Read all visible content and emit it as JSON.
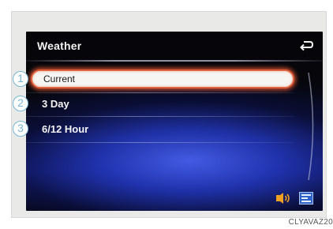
{
  "screen": {
    "title": "Weather",
    "back_icon": "back-arrow-icon"
  },
  "menu": {
    "items": [
      {
        "label": "Current",
        "selected": true
      },
      {
        "label": "3 Day",
        "selected": false
      },
      {
        "label": "6/12 Hour",
        "selected": false
      }
    ]
  },
  "callouts": [
    "1",
    "2",
    "3"
  ],
  "status_icons": [
    "audio-signal-icon",
    "traffic-info-icon"
  ],
  "image_code": "CLYAVAZ20",
  "colors": {
    "selection_glow": "#e2643f",
    "callout": "#79b6d3",
    "accent_blue": "#3a56e0"
  }
}
